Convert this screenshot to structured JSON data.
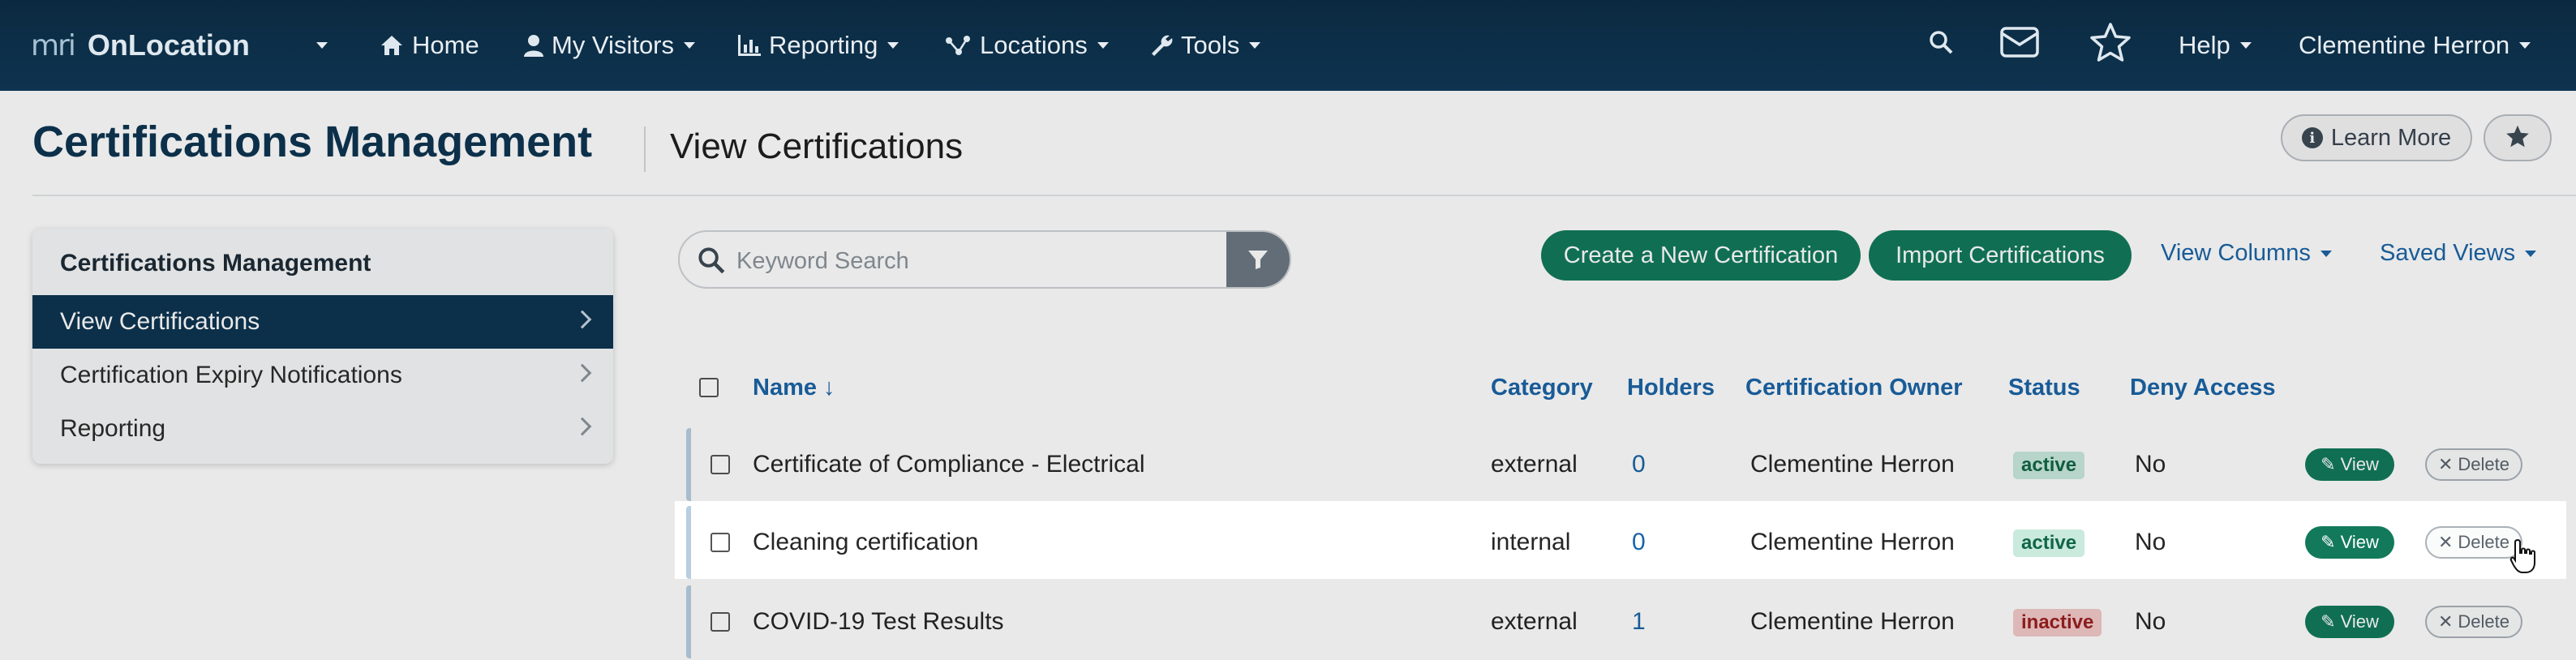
{
  "nav": {
    "logo_mark": "mri",
    "logo_text": "OnLocation",
    "items": [
      {
        "label": "Home",
        "icon": "home-icon"
      },
      {
        "label": "My Visitors",
        "icon": "user-icon"
      },
      {
        "label": "Reporting",
        "icon": "bar-chart-icon"
      },
      {
        "label": "Locations",
        "icon": "network-icon"
      },
      {
        "label": "Tools",
        "icon": "wrench-icon"
      }
    ],
    "help": "Help",
    "user": "Clementine Herron"
  },
  "page": {
    "title": "Certifications Management",
    "subtitle": "View Certifications",
    "learn_more": "Learn More"
  },
  "sidebar": {
    "heading": "Certifications Management",
    "items": [
      {
        "label": "View Certifications",
        "active": true
      },
      {
        "label": "Certification Expiry Notifications",
        "active": false
      },
      {
        "label": "Reporting",
        "active": false
      }
    ]
  },
  "toolbar": {
    "search_placeholder": "Keyword Search",
    "create_label": "Create a New Certification",
    "import_label": "Import Certifications",
    "view_columns": "View Columns",
    "saved_views": "Saved Views"
  },
  "table": {
    "headers": {
      "name": "Name ↓",
      "category": "Category",
      "holders": "Holders",
      "owner": "Certification Owner",
      "status": "Status",
      "deny": "Deny Access"
    },
    "view_label": "View",
    "delete_label": "Delete",
    "rows": [
      {
        "name": "Certificate of Compliance - Electrical",
        "category": "external",
        "holders": "0",
        "owner": "Clementine Herron",
        "status": "active",
        "deny": "No"
      },
      {
        "name": "Cleaning certification",
        "category": "internal",
        "holders": "0",
        "owner": "Clementine Herron",
        "status": "active",
        "deny": "No"
      },
      {
        "name": "COVID-19 Test Results",
        "category": "external",
        "holders": "1",
        "owner": "Clementine Herron",
        "status": "inactive",
        "deny": "No"
      }
    ]
  },
  "colors": {
    "nav_bg": "#0e3350",
    "brand_green": "#127a5a",
    "link_blue": "#1b64a6",
    "title_navy": "#0e3552"
  }
}
